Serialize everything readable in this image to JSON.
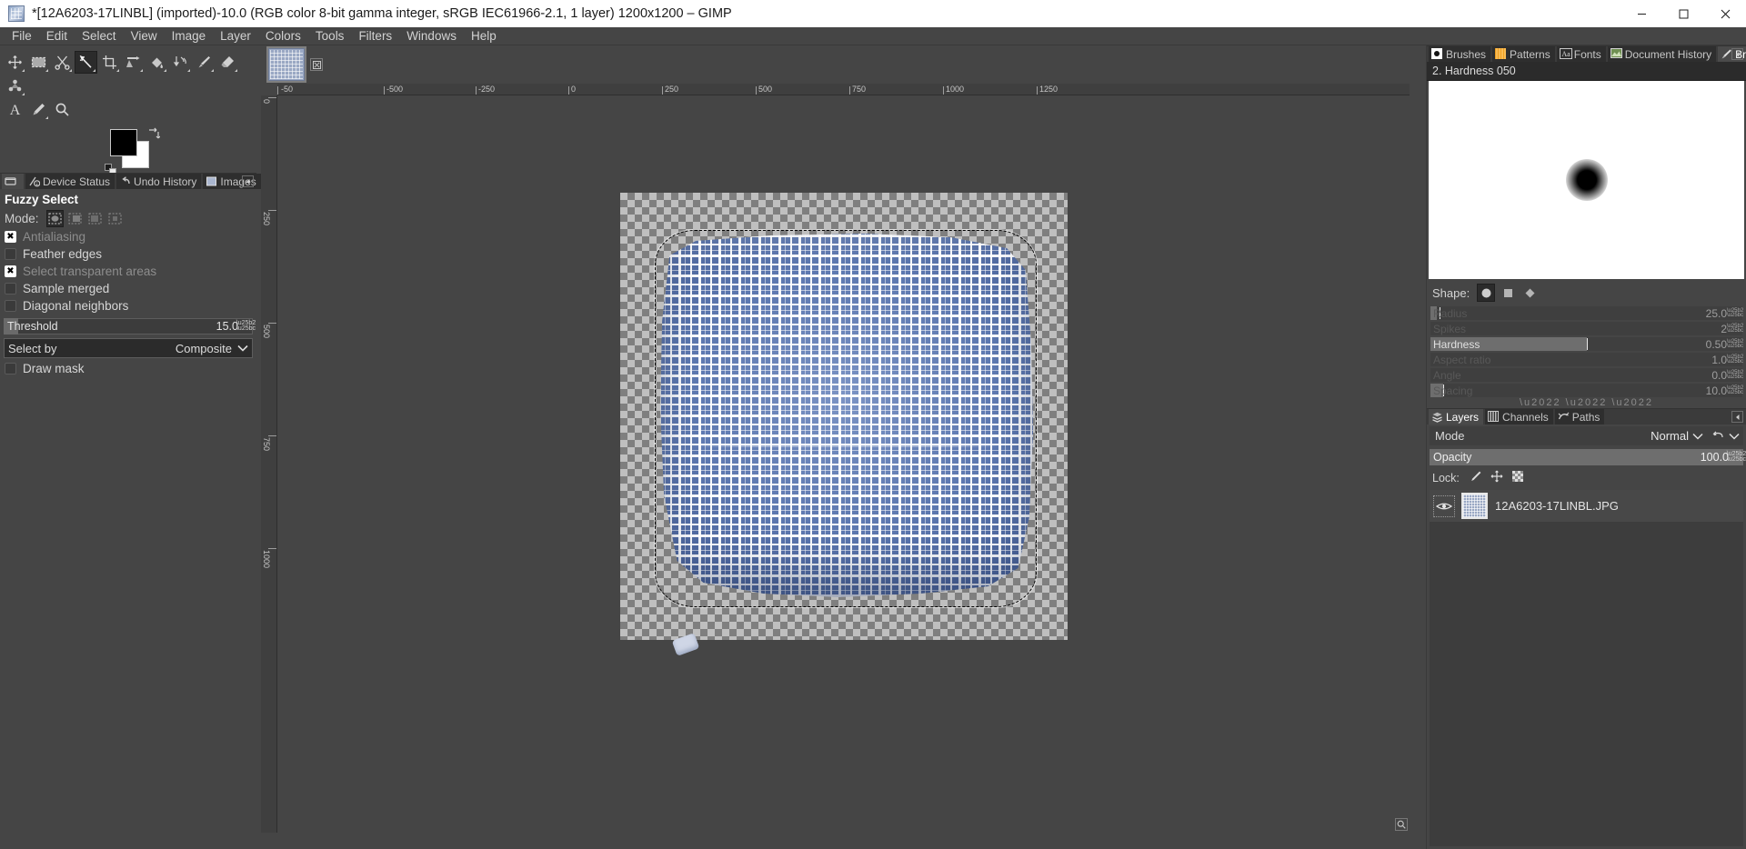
{
  "window": {
    "title": "*[12A6203-17LINBL] (imported)-10.0 (RGB color 8-bit gamma integer, sRGB IEC61966-2.1, 1 layer) 1200x1200 – GIMP",
    "icon": "gimp-wilber-icon",
    "controls": {
      "minimize": "–",
      "maximize": "□",
      "close": "✕"
    }
  },
  "menubar": {
    "items": [
      "File",
      "Edit",
      "Select",
      "View",
      "Image",
      "Layer",
      "Colors",
      "Tools",
      "Filters",
      "Windows",
      "Help"
    ]
  },
  "toolbox": {
    "row1": [
      {
        "name": "move-tool",
        "active": false
      },
      {
        "name": "rectangle-select-tool",
        "active": false
      },
      {
        "name": "scissors-select-tool",
        "active": false
      },
      {
        "name": "fuzzy-select-tool",
        "active": true
      },
      {
        "name": "crop-tool",
        "active": false
      },
      {
        "name": "transform-tool",
        "active": false
      },
      {
        "name": "bucket-fill-tool",
        "active": false
      },
      {
        "name": "gradient-tool",
        "active": false
      },
      {
        "name": "paintbrush-tool",
        "active": false
      },
      {
        "name": "eraser-tool",
        "active": false
      },
      {
        "name": "smudge-tool",
        "active": false
      }
    ],
    "row2": [
      {
        "name": "text-tool",
        "active": false
      },
      {
        "name": "pencil-tool",
        "active": false
      },
      {
        "name": "zoom-tool",
        "active": false
      }
    ],
    "colors": {
      "foreground": "#000000",
      "background": "#ffffff",
      "swap_name": "swap-colors-icon",
      "reset_name": "reset-colors-icon"
    }
  },
  "left_dock": {
    "tabs": [
      {
        "label": "",
        "icon": "tool-options-icon",
        "active": true
      },
      {
        "label": "Device Status",
        "icon": "device-status-icon",
        "active": false
      },
      {
        "label": "Undo History",
        "icon": "undo-history-icon",
        "active": false
      },
      {
        "label": "Images",
        "icon": "images-icon",
        "active": false
      }
    ],
    "menu_button": "dock-menu-icon"
  },
  "tool_options": {
    "title": "Fuzzy Select",
    "mode_label": "Mode:",
    "modes": [
      {
        "name": "replace-selection",
        "active": true
      },
      {
        "name": "add-to-selection",
        "active": false
      },
      {
        "name": "subtract-from-selection",
        "active": false
      },
      {
        "name": "intersect-with-selection",
        "active": false
      }
    ],
    "checkboxes": [
      {
        "label": "Antialiasing",
        "checked": true,
        "dimmed": true
      },
      {
        "label": "Feather edges",
        "checked": false,
        "dimmed": false
      },
      {
        "label": "Select transparent areas",
        "checked": true,
        "dimmed": true
      },
      {
        "label": "Sample merged",
        "checked": false,
        "dimmed": false
      },
      {
        "label": "Diagonal neighbors",
        "checked": false,
        "dimmed": false
      }
    ],
    "threshold": {
      "label": "Threshold",
      "value": "15.0",
      "percent": 6
    },
    "select_by": {
      "label": "Select by",
      "value": "Composite"
    },
    "draw_mask": {
      "label": "Draw mask",
      "checked": false
    }
  },
  "canvas": {
    "image_tab_name": "image-thumbnail-tab",
    "close_tab": "⊠",
    "ruler_h_labels": [
      "-50",
      "-500",
      "-250",
      "0",
      "250",
      "500",
      "750",
      "1000",
      "1250"
    ],
    "ruler_v_labels": [
      "0",
      "250",
      "500",
      "750",
      "1000"
    ],
    "navigation_icon": "navigation-preview-icon"
  },
  "right_dock": {
    "tabs": [
      {
        "label": "Brushes",
        "icon": "brushes-icon",
        "active": false
      },
      {
        "label": "Patterns",
        "icon": "patterns-icon",
        "active": false
      },
      {
        "label": "Fonts",
        "icon": "fonts-icon",
        "active": false
      },
      {
        "label": "Document History",
        "icon": "document-history-icon",
        "active": false
      },
      {
        "label": "Brush Editor",
        "icon": "brush-editor-icon",
        "active": true
      }
    ],
    "menu_button": "dock-menu-icon"
  },
  "brush_editor": {
    "brush_name": "2. Hardness 050",
    "preview_name": "brush-preview",
    "shape_label": "Shape:",
    "shapes": [
      {
        "name": "shape-circle",
        "active": true
      },
      {
        "name": "shape-square",
        "active": false
      },
      {
        "name": "shape-diamond",
        "active": false
      }
    ],
    "sliders": [
      {
        "label": "Radius",
        "value": "25.0",
        "percent": 2,
        "dimmed": true
      },
      {
        "label": "Spikes",
        "value": "2",
        "percent": 0,
        "dimmed": true
      },
      {
        "label": "Hardness",
        "value": "0.50",
        "percent": 50,
        "dimmed": false
      },
      {
        "label": "Aspect ratio",
        "value": "1.0",
        "percent": 0,
        "dimmed": true
      },
      {
        "label": "Angle",
        "value": "0.0",
        "percent": 0,
        "dimmed": true
      },
      {
        "label": "Spacing",
        "value": "10.0",
        "percent": 4,
        "dimmed": true
      }
    ]
  },
  "layers_dock": {
    "tabs": [
      {
        "label": "Layers",
        "icon": "layers-icon",
        "active": true
      },
      {
        "label": "Channels",
        "icon": "channels-icon",
        "active": false
      },
      {
        "label": "Paths",
        "icon": "paths-icon",
        "active": false
      }
    ],
    "menu_button": "dock-menu-icon",
    "mode": {
      "label": "Mode",
      "value": "Normal",
      "reset_icon": "reset-blend-icon"
    },
    "opacity": {
      "label": "Opacity",
      "value": "100.0",
      "percent": 100
    },
    "lock": {
      "label": "Lock:",
      "items": [
        {
          "name": "lock-pixels-icon"
        },
        {
          "name": "lock-position-icon"
        },
        {
          "name": "lock-alpha-icon"
        }
      ]
    },
    "layers": [
      {
        "name": "12A6203-17LINBL.JPG",
        "visible": true,
        "thumbnail": "layer-thumbnail"
      }
    ]
  }
}
